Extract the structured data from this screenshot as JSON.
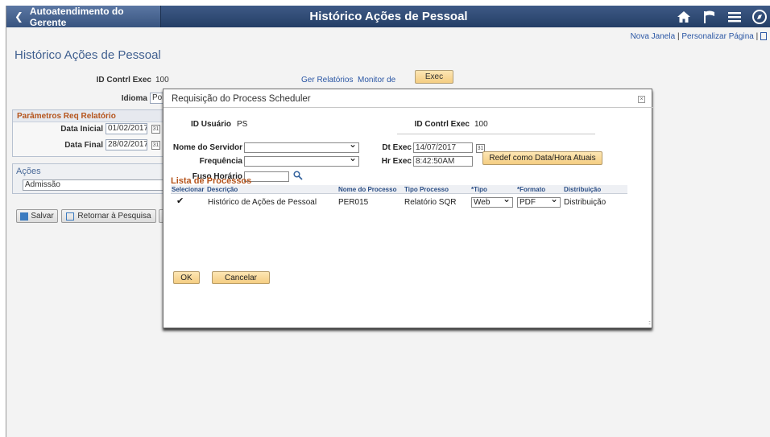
{
  "header": {
    "back_label": "Autoatendimento do Gerente",
    "title": "Histórico Ações de Pessoal",
    "icons": [
      "home-icon",
      "flag-icon",
      "menu-icon",
      "navbar-icon"
    ]
  },
  "top_links": {
    "new_window": "Nova Janela",
    "separator": "|",
    "personalize": "Personalizar Página",
    "separator2": "|"
  },
  "page": {
    "heading": "Histórico Ações de Pessoal",
    "run_control_label": "ID Contrl Exec",
    "run_control_value": "100",
    "language_label": "Idioma",
    "language_value": "Por",
    "report_manager": "Ger Relatórios",
    "process_monitor": "Monitor de",
    "exec_button": "Exec",
    "params_title": "Parâmetros Req Relatório",
    "start_date_label": "Data Inicial",
    "start_date_value": "01/02/2017",
    "end_date_label": "Data Final",
    "end_date_value": "28/02/2017",
    "actions_title": "Ações",
    "actions_value": "Admissão",
    "save_button": "Salvar",
    "return_button": "Retornar à Pesquisa"
  },
  "modal": {
    "title": "Requisição do Process Scheduler",
    "close": "×",
    "user_id_label": "ID Usuário",
    "user_id_value": "PS",
    "run_control_label": "ID Contrl Exec",
    "run_control_value": "100",
    "server_label": "Nome do Servidor",
    "server_value": "",
    "run_date_label": "Dt Exec",
    "run_date_value": "14/07/2017",
    "recurrence_label": "Frequência",
    "recurrence_value": "",
    "run_time_label": "Hr Exec",
    "run_time_value": "8:42:50AM",
    "reset_button": "Redef como Data/Hora Atuais",
    "timezone_label": "Fuso Horário",
    "timezone_value": "",
    "process_list_title": "Lista de Processos",
    "columns": [
      "Selecionar",
      "Descrição",
      "Nome do Processo",
      "Tipo Processo",
      "*Tipo",
      "*Formato",
      "Distribuição"
    ],
    "rows": [
      {
        "selected": true,
        "description": "Histórico de Ações de Pessoal",
        "process_name": "PER015",
        "process_type": "Relatório SQR",
        "type": "Web",
        "format": "PDF",
        "distribution": "Distribuição"
      }
    ],
    "ok_button": "OK",
    "cancel_button": "Cancelar"
  }
}
